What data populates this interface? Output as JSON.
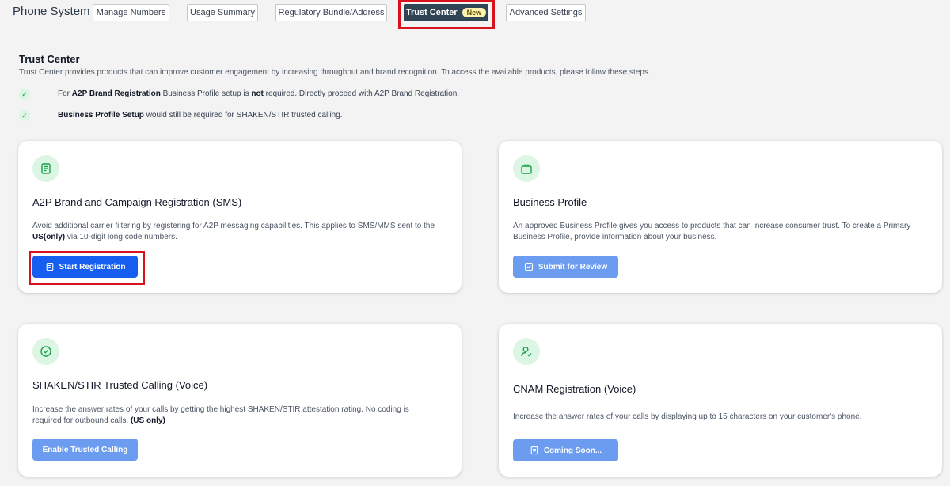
{
  "header": {
    "brand": "Phone System",
    "tabs": [
      {
        "label": "Manage Numbers"
      },
      {
        "label": "Usage Summary"
      },
      {
        "label": "Regulatory Bundle/Address"
      },
      {
        "label": "Trust Center",
        "badge": "New"
      },
      {
        "label": "Advanced Settings"
      }
    ]
  },
  "intro": {
    "title": "Trust Center",
    "description": "Trust Center provides products that can improve customer engagement by increasing throughput and brand recognition. To access the available products, please follow these steps.",
    "steps": [
      {
        "pre": "For ",
        "bold1": "A2P Brand Registration",
        "mid": " Business Profile setup is ",
        "bold2": "not",
        "post": " required. Directly proceed with A2P Brand Registration."
      },
      {
        "bold1": "Business Profile Setup",
        "post": " would still be required for SHAKEN/STIR trusted calling."
      }
    ]
  },
  "cards": {
    "a2p": {
      "title": "A2P Brand and Campaign Registration (SMS)",
      "desc1": "Avoid additional carrier filtering by registering for A2P messaging capabilities. This applies to SMS/MMS sent to the",
      "desc2_bold": "US(only)",
      "desc2_rest": " via 10-digit long code numbers.",
      "button": "Start Registration"
    },
    "business": {
      "title": "Business Profile",
      "desc1": "An approved Business Profile gives you access to products that can increase consumer trust. To create a Primary",
      "desc2": "Business Profile, provide information about your business.",
      "button": "Submit for Review"
    },
    "shaken": {
      "title": "SHAKEN/STIR Trusted Calling (Voice)",
      "desc1": "Increase the answer rates of your calls by getting the highest SHAKEN/STIR attestation rating. No coding is",
      "desc2": "required for outbound calls. ",
      "desc2_bold": "(US only)",
      "button": "Enable Trusted Calling"
    },
    "cnam": {
      "title": "CNAM Registration (Voice)",
      "desc1": "Increase the answer rates of your calls by displaying up to 15 characters on your customer's phone.",
      "button": "Coming Soon..."
    }
  },
  "colors": {
    "primary": "#155eef",
    "primary_light": "#6b9cf0",
    "active_tab": "#2f4553",
    "highlight": "#d9111a",
    "icon_bg": "#dcf5e5",
    "icon_fg": "#16a34a"
  }
}
